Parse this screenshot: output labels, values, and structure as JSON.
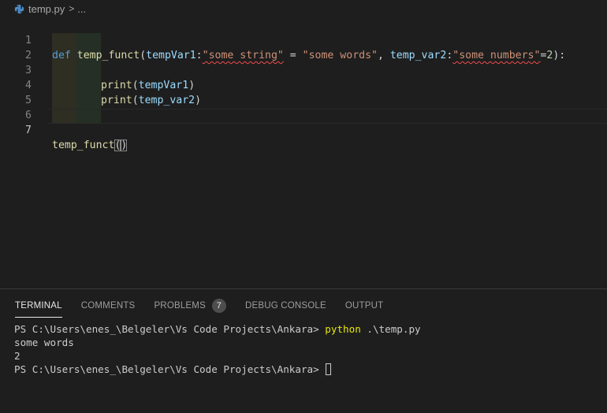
{
  "breadcrumb": {
    "file_icon": "python-icon",
    "file_name": "temp.py",
    "separator": ">",
    "more": "..."
  },
  "editor": {
    "active_line": "7",
    "lines": [
      {
        "number": "1"
      },
      {
        "number": "2"
      },
      {
        "number": "3"
      },
      {
        "number": "4"
      },
      {
        "number": "5"
      },
      {
        "number": "6"
      },
      {
        "number": "7"
      }
    ],
    "tokens": {
      "def": "def",
      "func_name": "temp_funct",
      "open_paren": "(",
      "param1": "tempVar1",
      "colon1": ":",
      "annot1": "\"some string\"",
      "eq1": " = ",
      "default1": "\"some words\"",
      "comma": ", ",
      "param2": "temp_var2",
      "colon2": ":",
      "annot2": "\"some numbers\"",
      "eq2": "=",
      "default2": "2",
      "close_sig": "):",
      "print": "print",
      "p_open": "(",
      "print_arg1": "tempVar1",
      "print_arg2": "temp_var2",
      "p_close": ")",
      "call_name": "temp_funct",
      "call_parens_open": "(",
      "call_parens_close": ")"
    }
  },
  "panel": {
    "tabs": [
      {
        "label": "TERMINAL"
      },
      {
        "label": "COMMENTS"
      },
      {
        "label": "PROBLEMS",
        "badge": "7"
      },
      {
        "label": "DEBUG CONSOLE"
      },
      {
        "label": "OUTPUT"
      }
    ],
    "terminal": {
      "prompt": "PS C:\\Users\\enes_\\Belgeler\\Vs Code Projects\\Ankara> ",
      "command": "python",
      "command_args": " .\\temp.py",
      "output1": "some words",
      "output2": "2"
    }
  },
  "colors": {
    "background": "#1e1e1e",
    "keyword": "#569cd6",
    "function": "#dcdcaa",
    "parameter": "#9cdcfe",
    "string": "#ce9178",
    "number": "#b5cea8",
    "terminal_command": "#e5e510"
  }
}
